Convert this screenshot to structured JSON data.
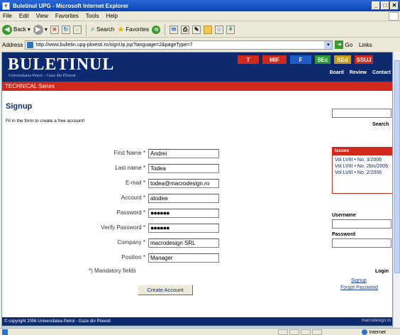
{
  "window": {
    "title": "Buletinul UPG - Microsoft Internet Explorer",
    "buttons": [
      "_",
      "□",
      "✕"
    ]
  },
  "menu": [
    "File",
    "Edit",
    "View",
    "Favorites",
    "Tools",
    "Help"
  ],
  "toolbar": {
    "back": "Back",
    "search": "Search",
    "favorites": "Favorites"
  },
  "address": {
    "label": "Address",
    "url": "http://www.bulletin.upg-ploiesti.ro/signUp.jsp?language=2&pageType=7",
    "go": "Go",
    "links": "Links"
  },
  "header": {
    "logo": "BULETINUL",
    "subtitle": "Universitatea Petrol – Gaze din Ploiesti",
    "tabs": [
      {
        "label": "T",
        "color": "#d0281a"
      },
      {
        "label": "MIF",
        "color": "#d0281a"
      },
      {
        "label": "F",
        "color": "#1e5cc8"
      },
      {
        "label": "SEc",
        "color": "#2e9a3a"
      },
      {
        "label": "SEd",
        "color": "#c79a1e"
      },
      {
        "label": "SSUJ",
        "color": "#d0281a"
      }
    ],
    "nav": [
      "Board",
      "Review",
      "Contact"
    ]
  },
  "series": "TECHNICAL Series",
  "page": {
    "title": "Signup",
    "intro": "Fil in the form to create a free account!"
  },
  "form": {
    "fields": [
      {
        "label": "First Name",
        "value": "Andrei"
      },
      {
        "label": "Last name",
        "value": "Todea"
      },
      {
        "label": "E-mail",
        "value": "todea@macrodesign.ro"
      },
      {
        "label": "Account",
        "value": "atodea"
      },
      {
        "label": "Password",
        "value": "●●●●●●"
      },
      {
        "label": "Verify Password",
        "value": "●●●●●●"
      },
      {
        "label": "Company",
        "value": "macrodesign SRL"
      },
      {
        "label": "Position",
        "value": "Manager"
      }
    ],
    "mandatory": "*) Mandatory fields",
    "submit": "Create Account"
  },
  "sidebar": {
    "search": "Search",
    "issues_title": "Issues",
    "issues": [
      "Vol LVIII • No. 3/2006",
      "Vol LVIII • No. 2bis/2006",
      "Vol LVIII • No. 2/2006"
    ],
    "username": "Username",
    "password": "Password",
    "login": "Login",
    "signup": "Signup",
    "forgot": "Forgot Password"
  },
  "footer": {
    "copyright": "© copyright 2006 Universitatea Petrol - Gaze din Ploiesti",
    "credit": "macrodesign.ro"
  },
  "status": {
    "zone": "Internet"
  }
}
